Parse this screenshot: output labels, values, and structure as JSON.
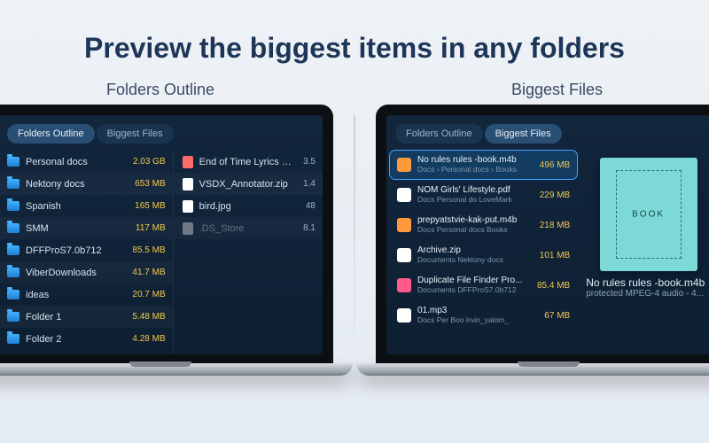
{
  "headline": "Preview the biggest items in any folders",
  "subheads": {
    "left": "Folders Outline",
    "right": "Biggest Files"
  },
  "left_screen": {
    "tabs": {
      "outline": "Folders Outline",
      "biggest": "Biggest Files",
      "active": "outline"
    },
    "folders": [
      {
        "name": "Personal docs",
        "size": "2.03 GB"
      },
      {
        "name": "Nektony docs",
        "size": "653 MB"
      },
      {
        "name": "Spanish",
        "size": "165 MB"
      },
      {
        "name": "SMM",
        "size": "117 MB"
      },
      {
        "name": "DFFProS7.0b712",
        "size": "85.5 MB"
      },
      {
        "name": "ViberDownloads",
        "size": "41.7 MB"
      },
      {
        "name": "ideas",
        "size": "20.7 MB"
      },
      {
        "name": "Folder 1",
        "size": "5.48 MB"
      },
      {
        "name": "Folder 2",
        "size": "4.28 MB"
      }
    ],
    "files": [
      {
        "name": "End of Time Lyrics -...",
        "ext": "3.5",
        "icon": "#ff6b6b"
      },
      {
        "name": "VSDX_Annotator.zip",
        "ext": "1.4",
        "icon": "#ffffff"
      },
      {
        "name": "bird.jpg",
        "ext": "48",
        "icon": "#ffffff"
      },
      {
        "name": ".DS_Store",
        "ext": "8.1",
        "icon": "#6d7a86"
      }
    ]
  },
  "right_screen": {
    "tabs": {
      "outline": "Folders Outline",
      "biggest": "Biggest Files",
      "active": "biggest"
    },
    "items": [
      {
        "name": "No rules rules -book.m4b",
        "path": "Docs › Personal docs › Books",
        "size": "496 MB",
        "icon": "#ff9a3c",
        "selected": true
      },
      {
        "name": "NOM Girls' Lifestyle.pdf",
        "path": "Docs  Personal do  LoveMark",
        "size": "229 MB",
        "icon": "#ffffff"
      },
      {
        "name": "prepyatstvie-kak-put.m4b",
        "path": "Docs  Personal docs  Books",
        "size": "218 MB",
        "icon": "#ff9a3c"
      },
      {
        "name": "Archive.zip",
        "path": "Documents  Nektony docs",
        "size": "101 MB",
        "icon": "#ffffff"
      },
      {
        "name": "Duplicate File Finder Pro...",
        "path": "Documents  DFFProS7.0b712",
        "size": "85.4 MB",
        "icon": "#ff5a8a"
      },
      {
        "name": "01.mp3",
        "path": "Docs  Per  Boo  Irvin_yalom_",
        "size": "67 MB",
        "icon": "#ffffff"
      }
    ],
    "preview": {
      "cover_word": "BOOK",
      "title": "No rules rules -book.m4b",
      "meta": "protected MPEG-4 audio - 4..."
    }
  }
}
